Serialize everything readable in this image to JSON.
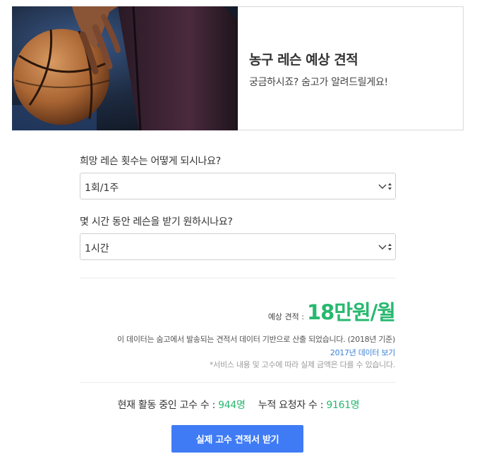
{
  "hero": {
    "title": "농구 레슨 예상 견적",
    "subtitle": "궁금하시죠? 숨고가 알려드릴게요!",
    "image_alt": "basketball-photo"
  },
  "question1": {
    "label": "희망 레슨 횟수는 어떻게 되시나요?",
    "selected": "1회/1주"
  },
  "question2": {
    "label": "몇 시간 동안 레슨을 받기 원하시나요?",
    "selected": "1시간"
  },
  "estimate": {
    "label": "예상 견적 :",
    "value": "18만원/월"
  },
  "notes": {
    "source": "이 데이터는 숨고에서 발송되는 견적서 데이터 기반으로 산출 되었습니다. (2018년 기준)",
    "link_2017": "2017년 데이터 보기",
    "disclaimer": "*서비스 내용 및 고수에 따라 실제 금액은 다를 수 있습니다."
  },
  "stats": {
    "active_label": "현재 활동 중인 고수 수 :",
    "active_value": "944명",
    "requesters_label": "누적 요청자 수 :",
    "requesters_value": "9161명"
  },
  "cta": {
    "label": "실제 고수 견적서 받기"
  },
  "colors": {
    "accent_green": "#27b86f",
    "cta_blue": "#3f7bf5",
    "link_blue": "#3b82d6"
  }
}
